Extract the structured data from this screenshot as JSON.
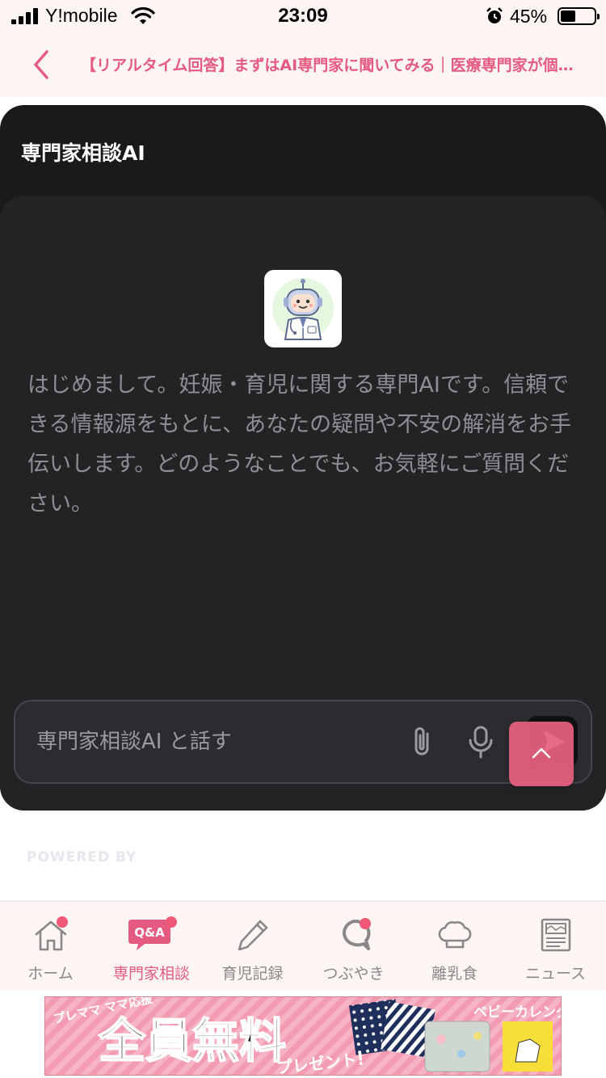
{
  "status_bar": {
    "carrier": "Y!mobile",
    "time": "23:09",
    "battery_percent": "45%",
    "battery_level": 0.45,
    "icons": [
      "signal-icon",
      "wifi-icon",
      "alarm-icon",
      "battery-icon"
    ]
  },
  "header": {
    "back_icon": "chevron-left-icon",
    "title": "【リアルタイム回答】まずはAI専門家に聞いてみる｜医療専門家が個…"
  },
  "chat": {
    "title": "専門家相談AI",
    "avatar_icon": "robot-doctor-icon",
    "intro_message": "はじめまして。妊娠・育児に関する専門AIです。信頼できる情報源をもとに、あなたの疑問や不安の解消をお手伝いします。どのようなことでも、お気軽にご質問ください。",
    "input_placeholder": "専門家相談AI と話す",
    "attach_icon": "paperclip-icon",
    "mic_icon": "microphone-icon",
    "send_icon": "send-icon"
  },
  "scroll_top_icon": "chevron-up-icon",
  "powered_by": "POWERED BY",
  "tabs": [
    {
      "label": "ホーム",
      "icon": "home-icon",
      "active": false,
      "badge": true
    },
    {
      "label": "専門家相談",
      "icon": "qa-bubble-icon",
      "active": true,
      "badge": true
    },
    {
      "label": "育児記録",
      "icon": "pencil-icon",
      "active": false,
      "badge": false
    },
    {
      "label": "つぶやき",
      "icon": "chat-bubble-icon",
      "active": false,
      "badge": true
    },
    {
      "label": "離乳食",
      "icon": "chef-hat-icon",
      "active": false,
      "badge": false
    },
    {
      "label": "ニュース",
      "icon": "newspaper-icon",
      "active": false,
      "badge": false
    }
  ],
  "banner": {
    "tagline": "プレママ ママ応援",
    "headline": "全員無料",
    "sub": "プレゼント!",
    "brand": "ベビーカレンダー"
  },
  "colors": {
    "accent": "#e55a80",
    "widget_bg": "#1a1a1c",
    "panel_bg": "#232326",
    "header_bg": "#fdf5f3"
  }
}
